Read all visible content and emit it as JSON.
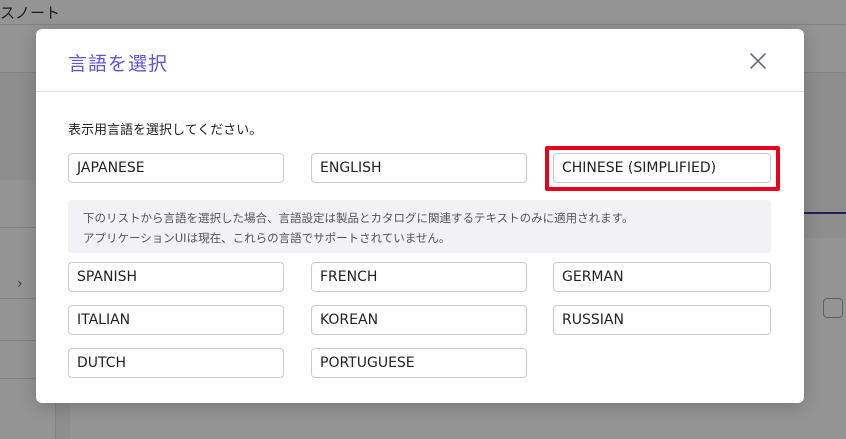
{
  "background": {
    "app_title": "スノート"
  },
  "modal": {
    "title": "言語を選択",
    "instruction": "表示用言語を選択してください。",
    "note": {
      "line1": "下のリストから言語を選択した場合、言語設定は製品とカタログに関連するテキストのみに適用されます。",
      "line2": "アプリケーションUIは現在、これらの言語でサポートされていません。"
    },
    "languages_top": [
      "JAPANESE",
      "ENGLISH",
      "CHINESE (SIMPLIFIED)"
    ],
    "languages_more": [
      "SPANISH",
      "FRENCH",
      "GERMAN",
      "ITALIAN",
      "KOREAN",
      "RUSSIAN",
      "DUTCH",
      "PORTUGUESE"
    ],
    "highlighted_language": "CHINESE (SIMPLIFIED)"
  },
  "colors": {
    "title": "#6b4fd8",
    "highlight": "#e8001c",
    "note_bg": "#f1f1f6"
  },
  "icons": {
    "close": "close-icon",
    "sidebar_chevron": "chevron-right-icon"
  }
}
